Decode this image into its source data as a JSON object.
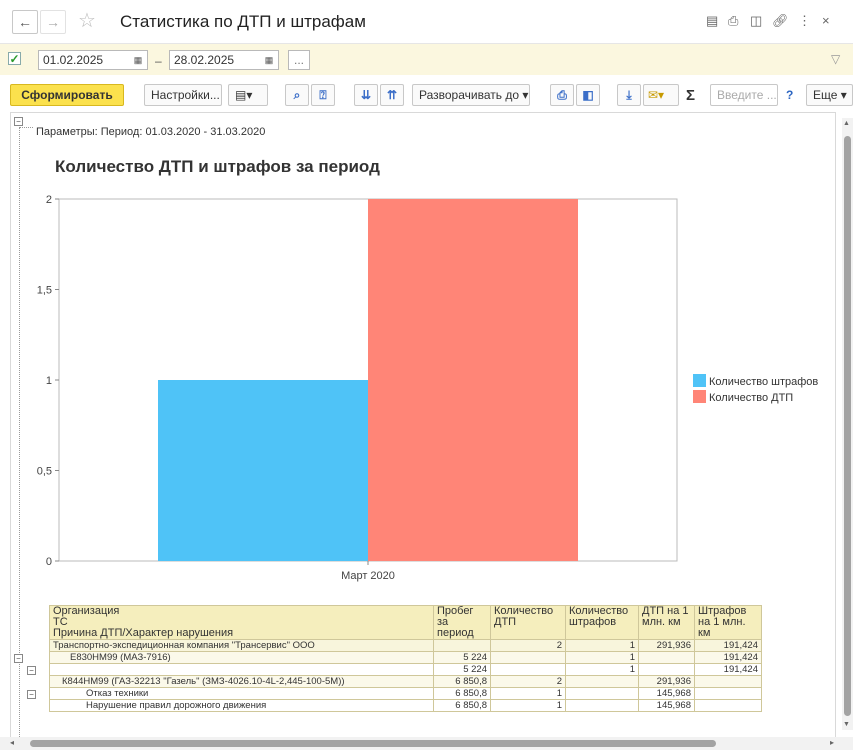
{
  "window": {
    "title": "Статистика по ДТП и штрафам"
  },
  "period": {
    "enabled": true,
    "date_from": "01.02.2025",
    "separator": "–",
    "date_to": "28.02.2025",
    "more_label": "..."
  },
  "toolbar": {
    "generate_label": "Сформировать",
    "settings_label": "Настройки...",
    "expand_to_label": "Разворачивать до",
    "search_placeholder": "Введите ...",
    "help_label": "?",
    "more_label": "Еще",
    "sum_label": "Σ"
  },
  "report": {
    "params": "Параметры:    Период: 01.03.2020 - 31.03.2020",
    "title": "Количество ДТП и штрафов за период"
  },
  "chart_data": {
    "type": "bar",
    "categories": [
      "Март 2020"
    ],
    "series": [
      {
        "name": "Количество штрафов",
        "values": [
          1
        ],
        "color": "#4fc3f7"
      },
      {
        "name": "Количество ДТП",
        "values": [
          2
        ],
        "color": "#ff8577"
      }
    ],
    "ylim": [
      0,
      2
    ],
    "yticks": [
      "0",
      "0,5",
      "1",
      "1,5",
      "2"
    ],
    "legend_position": "right"
  },
  "table": {
    "headers": {
      "org": "Организация",
      "ts": "ТС",
      "reason": "Причина ДТП/Характер нарушения",
      "mileage": "Пробег за период",
      "accidents": "Количество ДТП",
      "fines": "Количество штрафов",
      "acc_per_mln": "ДТП на 1 млн. км",
      "fines_per_mln": "Штрафов на 1 млн. км"
    },
    "rows": [
      {
        "name": "Транспортно-экспедиционная компания \"Трансервис\" ООО",
        "mileage": "",
        "accidents": "2",
        "fines": "1",
        "acc_per_mln": "291,936",
        "fines_per_mln": "191,424"
      },
      {
        "name": "Е830НМ99 (МАЗ-7916)",
        "mileage": "5 224",
        "accidents": "",
        "fines": "1",
        "acc_per_mln": "",
        "fines_per_mln": "191,424"
      },
      {
        "name": "",
        "mileage": "5 224",
        "accidents": "",
        "fines": "1",
        "acc_per_mln": "",
        "fines_per_mln": "191,424"
      },
      {
        "name": "К844НМ99 (ГАЗ-32213 \"Газель\" (ЗМЗ-4026.10-4L-2,445-100-5М))",
        "mileage": "6 850,8",
        "accidents": "2",
        "fines": "",
        "acc_per_mln": "291,936",
        "fines_per_mln": ""
      },
      {
        "name": "Отказ техники",
        "mileage": "6 850,8",
        "accidents": "1",
        "fines": "",
        "acc_per_mln": "145,968",
        "fines_per_mln": ""
      },
      {
        "name": "Нарушение правил дорожного движения",
        "mileage": "6 850,8",
        "accidents": "1",
        "fines": "",
        "acc_per_mln": "145,968",
        "fines_per_mln": ""
      }
    ]
  }
}
